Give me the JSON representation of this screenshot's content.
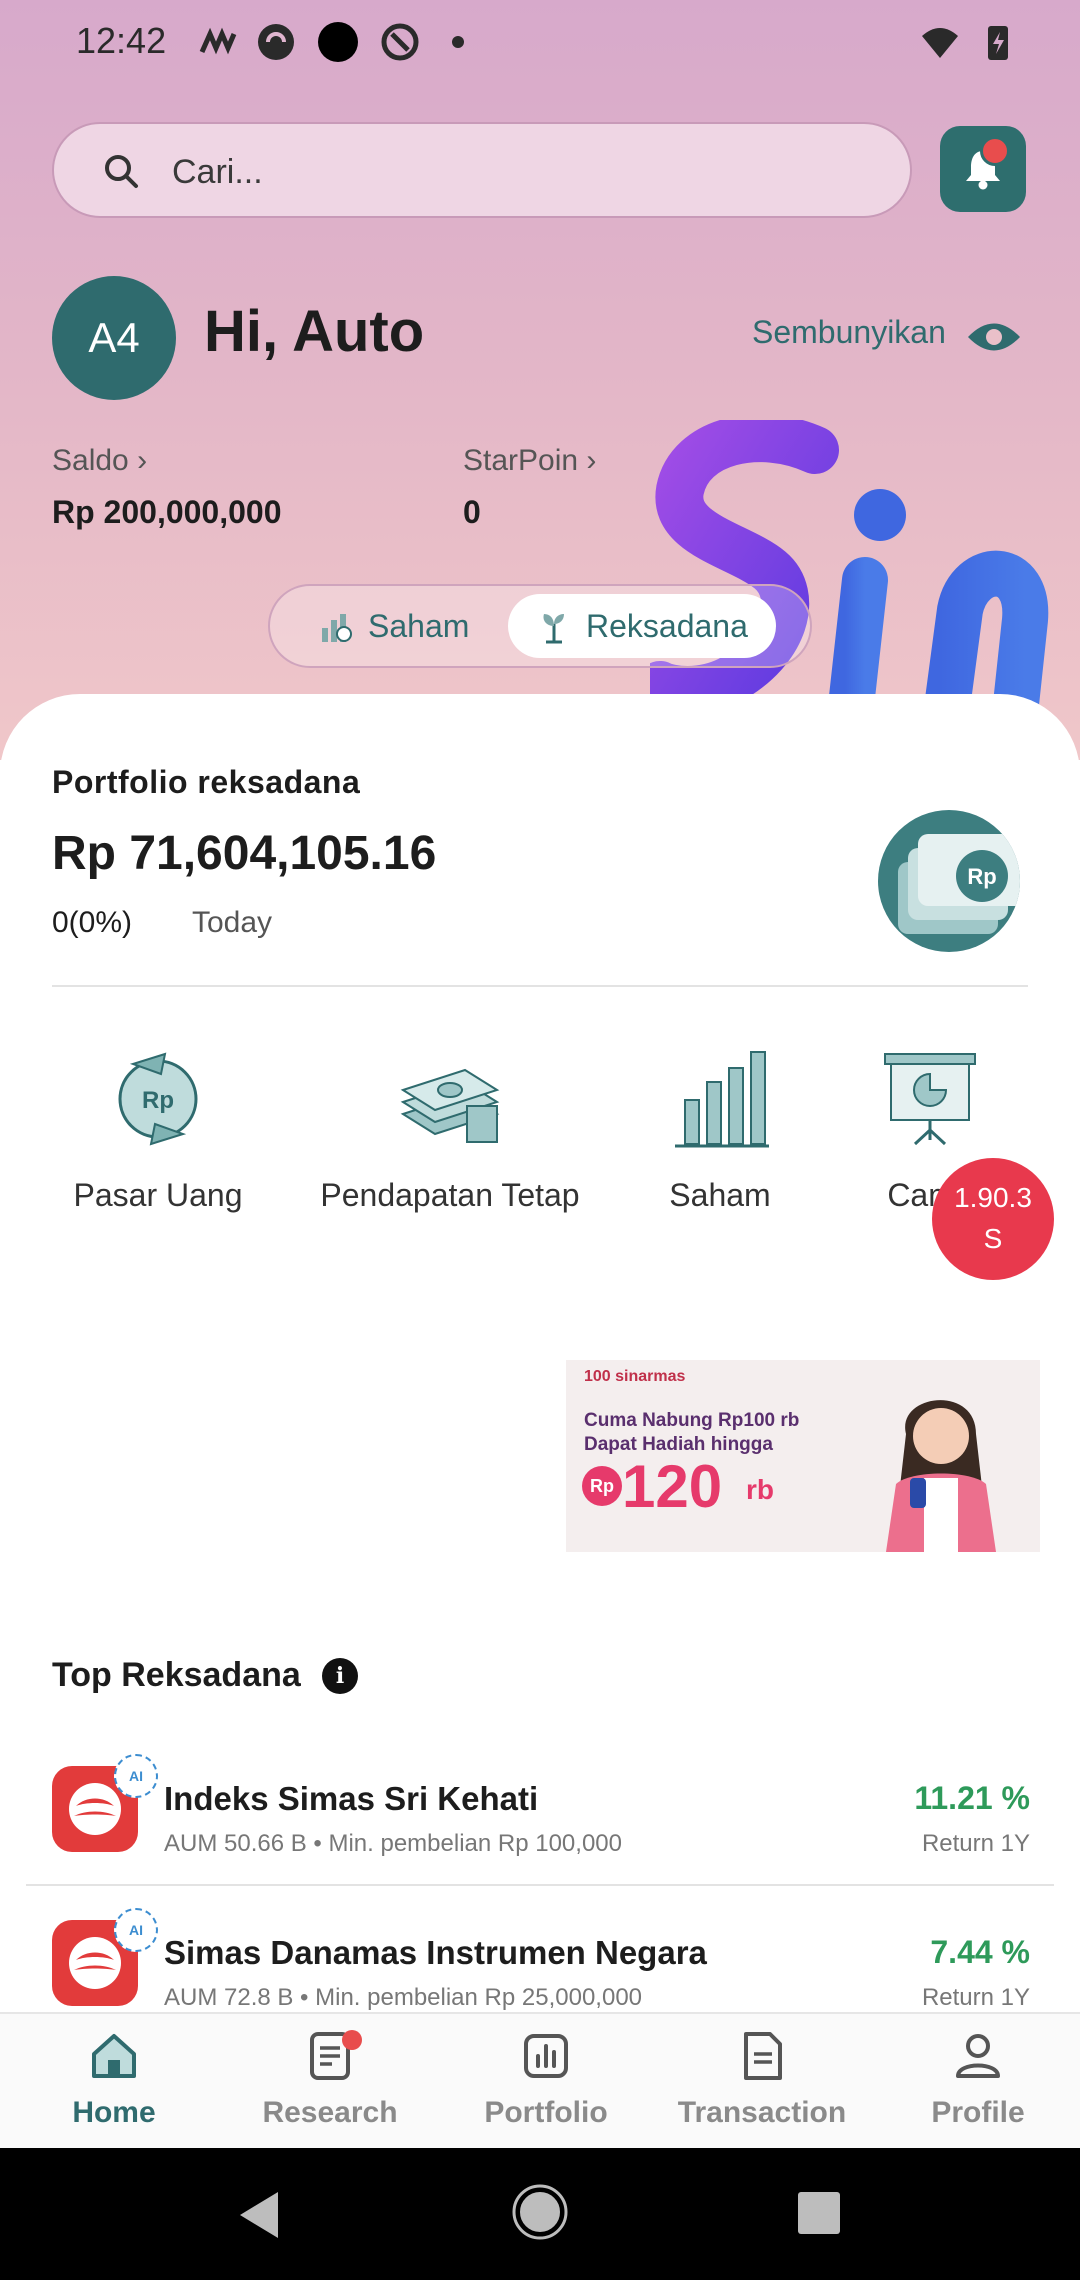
{
  "status_bar": {
    "time": "12:42"
  },
  "search": {
    "placeholder": "Cari..."
  },
  "user": {
    "initials": "A4",
    "greeting": "Hi, Auto",
    "hide_label": "Sembunyikan"
  },
  "balances": {
    "saldo_label": "Saldo",
    "saldo_value": "Rp 200,000,000",
    "starpoin_label": "StarPoin",
    "starpoin_value": "0"
  },
  "segment": {
    "tab_saham": "Saham",
    "tab_reksadana": "Reksadana",
    "active": "Reksadana"
  },
  "portfolio": {
    "title": "Portfolio reksadana",
    "value": "Rp 71,604,105.16",
    "change": "0(0%)",
    "period": "Today",
    "illustration_text": "Rp"
  },
  "categories": [
    {
      "label": "Pasar Uang",
      "icon": "money-market-icon"
    },
    {
      "label": "Pendapatan Tetap",
      "icon": "money-stack-icon"
    },
    {
      "label": "Saham",
      "icon": "bar-chart-icon"
    },
    {
      "label": "Camp",
      "icon": "presentation-icon"
    }
  ],
  "floating_badge": {
    "line1": "1.90.3",
    "line2": "S"
  },
  "banner": {
    "brand": "100 sinarmas",
    "line1": "Cuma Nabung Rp100 rb",
    "line2": "Dapat Hadiah hingga",
    "rp": "Rp",
    "amount": "120",
    "unit": "rb"
  },
  "top_funds": {
    "title": "Top Reksadana",
    "items": [
      {
        "name": "Indeks Simas Sri Kehati",
        "meta": "AUM 50.66 B • Min. pembelian Rp 100,000",
        "return": "11.21 %",
        "return_label": "Return 1Y",
        "ai": "AI"
      },
      {
        "name": "Simas Danamas Instrumen Negara",
        "meta": "AUM 72.8 B • Min. pembelian Rp 25,000,000",
        "return": "7.44 %",
        "return_label": "Return 1Y",
        "ai": "AI"
      }
    ]
  },
  "bottom_nav": [
    {
      "label": "Home",
      "active": true
    },
    {
      "label": "Research",
      "active": false,
      "has_dot": true
    },
    {
      "label": "Portfolio",
      "active": false
    },
    {
      "label": "Transaction",
      "active": false
    },
    {
      "label": "Profile",
      "active": false
    }
  ],
  "colors": {
    "teal": "#2f6b6e",
    "return_green": "#2e9a5a",
    "alert_red": "#e84d4d"
  }
}
